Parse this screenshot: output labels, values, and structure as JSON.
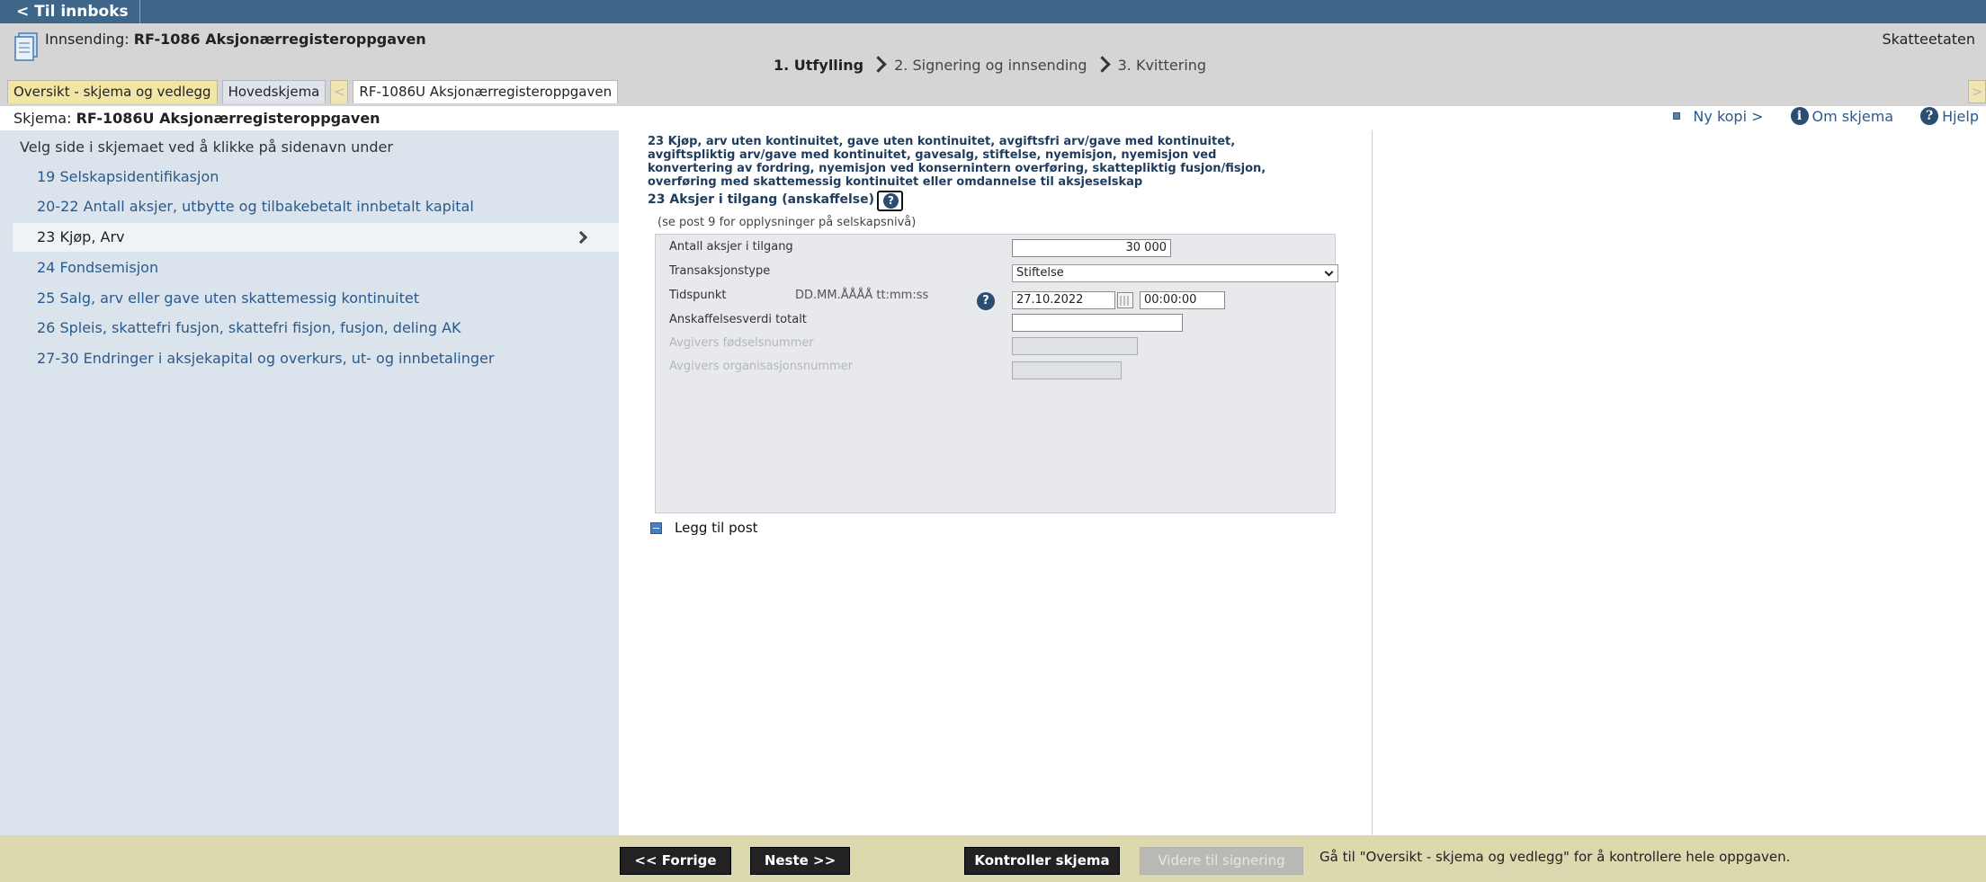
{
  "topbar": {
    "back_label": "< Til innboks"
  },
  "header": {
    "submission_prefix": "Innsending:",
    "submission_title": "RF-1086 Aksjonærregisteroppgaven",
    "agency": "Skatteetaten",
    "steps": [
      "1. Utfylling",
      "2. Signering og innsending",
      "3. Kvittering"
    ],
    "active_step": 0
  },
  "tabs": {
    "overview": "Oversikt - skjema og vedlegg",
    "main": "Hovedskjema",
    "prev_arrow": "<",
    "current": "RF-1086U Aksjonærregisteroppgaven",
    "next_arrow": ">"
  },
  "schema_bar": {
    "prefix": "Skjema:",
    "title": "RF-1086U Aksjonærregisteroppgaven",
    "new_copy": "Ny kopi >",
    "about": "Om skjema",
    "help": "Hjelp"
  },
  "sidebar": {
    "instruction": "Velg side i skjemaet ved å klikke på sidenavn under",
    "items": [
      "19 Selskapsidentifikasjon",
      "20-22 Antall aksjer, utbytte og tilbakebetalt innbetalt kapital",
      "23 Kjøp, Arv",
      "24 Fondsemisjon",
      "25 Salg, arv eller gave uten skattemessig kontinuitet",
      "26 Spleis, skattefri fusjon, skattefri fisjon, fusjon, deling AK",
      "27-30 Endringer i aksjekapital og overkurs, ut- og innbetalinger"
    ],
    "selected_index": 2
  },
  "main": {
    "section_heading": "23 Kjøp, arv uten kontinuitet, gave uten kontinuitet, avgiftsfri arv/gave med kontinuitet, avgiftspliktig arv/gave med kontinuitet, gavesalg, stiftelse, nyemisjon, nyemisjon ved konvertering av fordring, nyemisjon ved konsernintern overføring, skattepliktig fusjon/fisjon, overføring med skattemessig kontinuitet eller omdannelse til aksjeselskap",
    "sub_heading": "23 Aksjer i tilgang (anskaffelse)",
    "note": "(se post 9 for opplysninger på selskapsnivå)",
    "form": {
      "shares_label": "Antall aksjer i tilgang",
      "shares_value": "30 000",
      "txn_type_label": "Transaksjonstype",
      "txn_type_value": "Stiftelse",
      "time_label": "Tidspunkt",
      "time_format": "DD.MM.ÅÅÅÅ tt:mm:ss",
      "date_value": "27.10.2022",
      "time_value": "00:00:00",
      "cost_label": "Anskaffelsesverdi totalt",
      "cost_value": "",
      "birth_no_label": "Avgivers fødselsnummer",
      "org_no_label": "Avgivers organisasjonsnummer"
    },
    "add_post": "Legg til post"
  },
  "footer": {
    "prev": "<< Forrige",
    "next": "Neste >>",
    "check": "Kontroller skjema",
    "to_signing": "Videre til signering",
    "note": "Gå til \"Oversikt - skjema og vedlegg\" for å kontrollere hele oppgaven."
  },
  "icons": [
    "document-icon",
    "info-icon",
    "help-icon",
    "calendar-icon",
    "square-bullet-icon",
    "add-icon",
    "chevron-right-icon",
    "dropdown-arrow-icon"
  ],
  "colors": {
    "topbar": "#3d6688",
    "header": "#d5d5d5",
    "sidebar": "#dbe4ec",
    "footer": "#ddd9ae",
    "link": "#2a5a8c",
    "heading": "#1e3c5e"
  }
}
